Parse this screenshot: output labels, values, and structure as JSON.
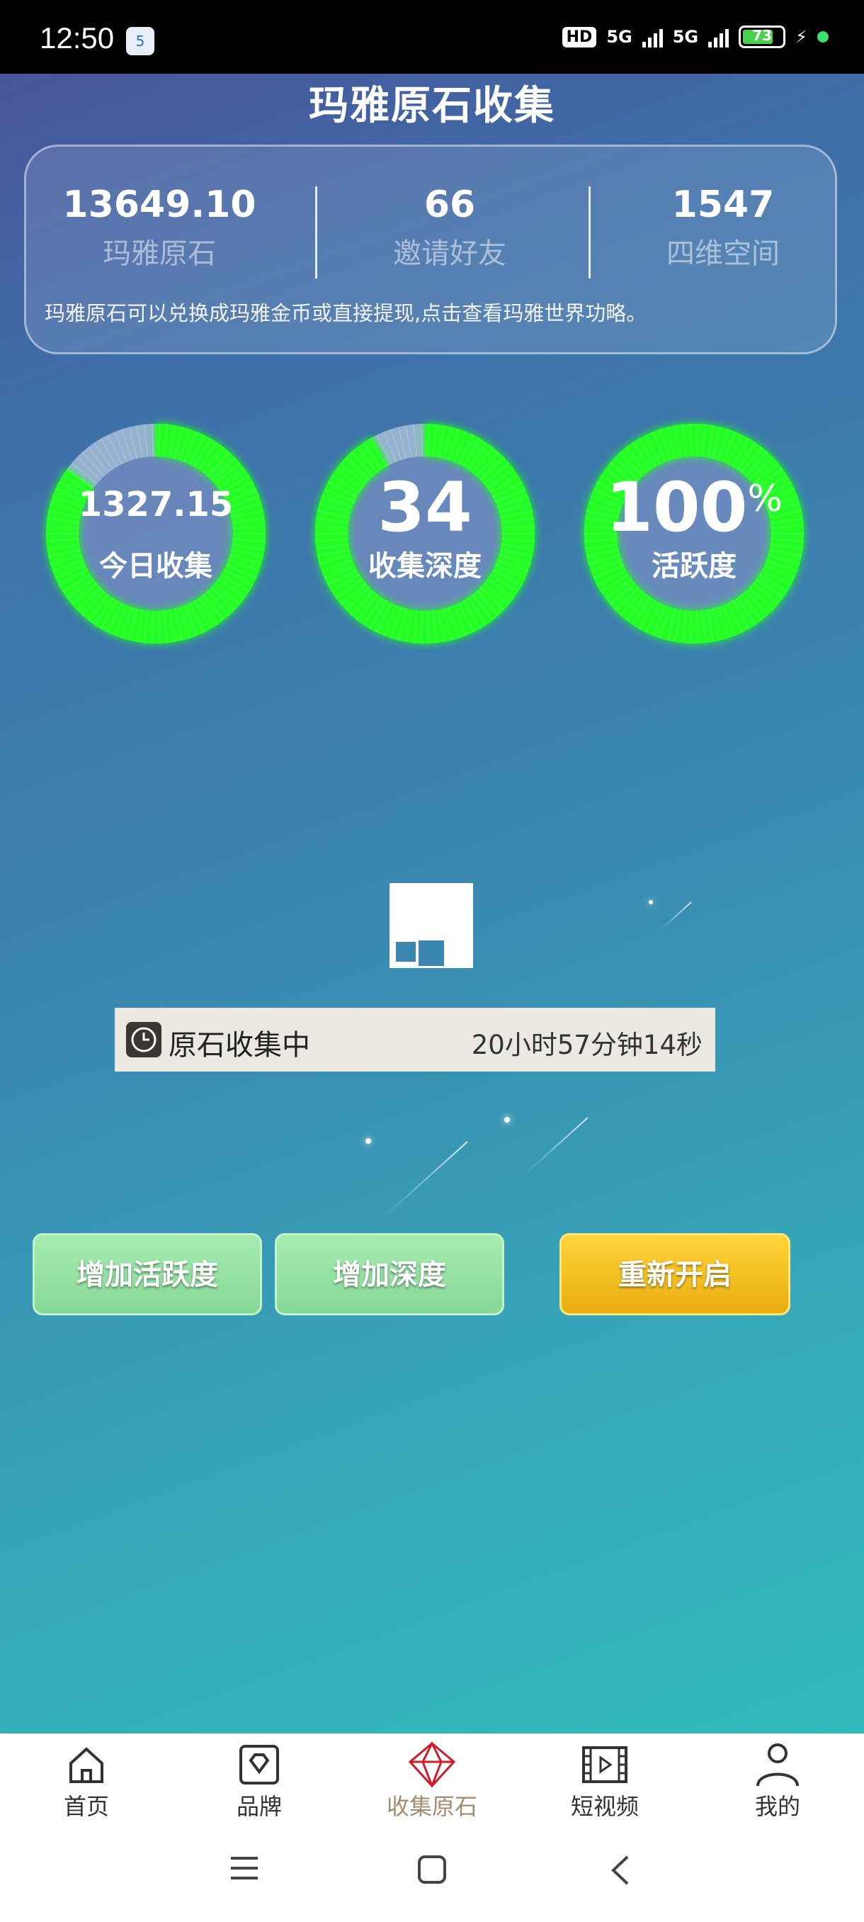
{
  "status_bar": {
    "time": "12:50",
    "app_badge": "5",
    "hd_label": "HD",
    "network1": "5G",
    "network2": "5G",
    "battery_level": "73"
  },
  "page": {
    "title": "玛雅原石收集"
  },
  "stats": {
    "items": [
      {
        "value": "13649.10",
        "label": "玛雅原石"
      },
      {
        "value": "66",
        "label": "邀请好友"
      },
      {
        "value": "1547",
        "label": "四维空间"
      }
    ],
    "note": "玛雅原石可以兑换成玛雅金币或直接提现,点击查看玛雅世界功略。"
  },
  "rings": [
    {
      "value": "1327.15",
      "label": "今日收集",
      "fill_fraction": 0.85
    },
    {
      "value": "34",
      "label": "收集深度",
      "fill_fraction": 0.92
    },
    {
      "value": "100",
      "unit": "%",
      "label": "活跃度",
      "fill_fraction": 1.0
    }
  ],
  "collection": {
    "status_label": "原石收集中",
    "countdown": "20小时57分钟14秒"
  },
  "actions": {
    "increase_activity": "增加活跃度",
    "increase_depth": "增加深度",
    "restart": "重新开启"
  },
  "tabs": [
    {
      "label": "首页",
      "icon": "home-icon"
    },
    {
      "label": "品牌",
      "icon": "diamond-icon"
    },
    {
      "label": "收集原石",
      "icon": "gem-icon",
      "active": true
    },
    {
      "label": "短视频",
      "icon": "video-icon"
    },
    {
      "label": "我的",
      "icon": "user-icon"
    }
  ],
  "colors": {
    "ring_green": "#22ff22",
    "active_tab_text": "#a58b6f",
    "active_tab_icon": "#d11a2a",
    "restart_button": "#f2c02a",
    "secondary_buttons": "#8fdf9e"
  }
}
